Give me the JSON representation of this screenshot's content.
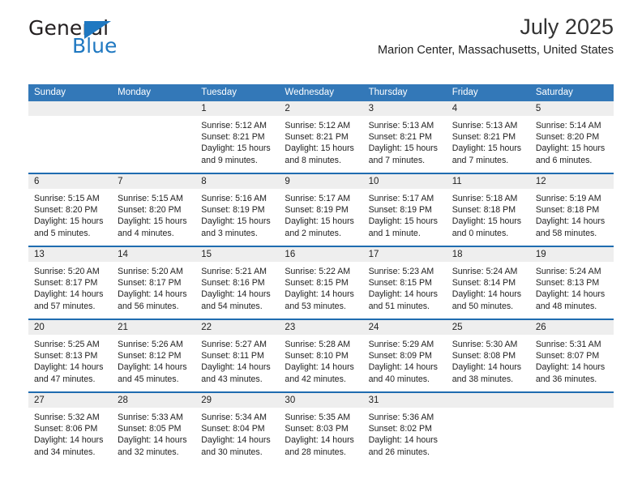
{
  "brand": {
    "name_part1": "General",
    "name_part2": "Blue",
    "triangle_color": "#1f78c1"
  },
  "header": {
    "title": "July 2025",
    "subtitle": "Marion Center, Massachusetts, United States"
  },
  "theme": {
    "header_bg": "#3378b8",
    "row_divider": "#1f6cb0",
    "day_number_bg": "#eeeeee",
    "text": "#222222"
  },
  "calendar": {
    "weekday_headers": [
      "Sunday",
      "Monday",
      "Tuesday",
      "Wednesday",
      "Thursday",
      "Friday",
      "Saturday"
    ],
    "weeks": [
      [
        {
          "day": "",
          "sunrise": "",
          "sunset": "",
          "daylight_line1": "",
          "daylight_line2": ""
        },
        {
          "day": "",
          "sunrise": "",
          "sunset": "",
          "daylight_line1": "",
          "daylight_line2": ""
        },
        {
          "day": "1",
          "sunrise": "Sunrise: 5:12 AM",
          "sunset": "Sunset: 8:21 PM",
          "daylight_line1": "Daylight: 15 hours",
          "daylight_line2": "and 9 minutes."
        },
        {
          "day": "2",
          "sunrise": "Sunrise: 5:12 AM",
          "sunset": "Sunset: 8:21 PM",
          "daylight_line1": "Daylight: 15 hours",
          "daylight_line2": "and 8 minutes."
        },
        {
          "day": "3",
          "sunrise": "Sunrise: 5:13 AM",
          "sunset": "Sunset: 8:21 PM",
          "daylight_line1": "Daylight: 15 hours",
          "daylight_line2": "and 7 minutes."
        },
        {
          "day": "4",
          "sunrise": "Sunrise: 5:13 AM",
          "sunset": "Sunset: 8:21 PM",
          "daylight_line1": "Daylight: 15 hours",
          "daylight_line2": "and 7 minutes."
        },
        {
          "day": "5",
          "sunrise": "Sunrise: 5:14 AM",
          "sunset": "Sunset: 8:20 PM",
          "daylight_line1": "Daylight: 15 hours",
          "daylight_line2": "and 6 minutes."
        }
      ],
      [
        {
          "day": "6",
          "sunrise": "Sunrise: 5:15 AM",
          "sunset": "Sunset: 8:20 PM",
          "daylight_line1": "Daylight: 15 hours",
          "daylight_line2": "and 5 minutes."
        },
        {
          "day": "7",
          "sunrise": "Sunrise: 5:15 AM",
          "sunset": "Sunset: 8:20 PM",
          "daylight_line1": "Daylight: 15 hours",
          "daylight_line2": "and 4 minutes."
        },
        {
          "day": "8",
          "sunrise": "Sunrise: 5:16 AM",
          "sunset": "Sunset: 8:19 PM",
          "daylight_line1": "Daylight: 15 hours",
          "daylight_line2": "and 3 minutes."
        },
        {
          "day": "9",
          "sunrise": "Sunrise: 5:17 AM",
          "sunset": "Sunset: 8:19 PM",
          "daylight_line1": "Daylight: 15 hours",
          "daylight_line2": "and 2 minutes."
        },
        {
          "day": "10",
          "sunrise": "Sunrise: 5:17 AM",
          "sunset": "Sunset: 8:19 PM",
          "daylight_line1": "Daylight: 15 hours",
          "daylight_line2": "and 1 minute."
        },
        {
          "day": "11",
          "sunrise": "Sunrise: 5:18 AM",
          "sunset": "Sunset: 8:18 PM",
          "daylight_line1": "Daylight: 15 hours",
          "daylight_line2": "and 0 minutes."
        },
        {
          "day": "12",
          "sunrise": "Sunrise: 5:19 AM",
          "sunset": "Sunset: 8:18 PM",
          "daylight_line1": "Daylight: 14 hours",
          "daylight_line2": "and 58 minutes."
        }
      ],
      [
        {
          "day": "13",
          "sunrise": "Sunrise: 5:20 AM",
          "sunset": "Sunset: 8:17 PM",
          "daylight_line1": "Daylight: 14 hours",
          "daylight_line2": "and 57 minutes."
        },
        {
          "day": "14",
          "sunrise": "Sunrise: 5:20 AM",
          "sunset": "Sunset: 8:17 PM",
          "daylight_line1": "Daylight: 14 hours",
          "daylight_line2": "and 56 minutes."
        },
        {
          "day": "15",
          "sunrise": "Sunrise: 5:21 AM",
          "sunset": "Sunset: 8:16 PM",
          "daylight_line1": "Daylight: 14 hours",
          "daylight_line2": "and 54 minutes."
        },
        {
          "day": "16",
          "sunrise": "Sunrise: 5:22 AM",
          "sunset": "Sunset: 8:15 PM",
          "daylight_line1": "Daylight: 14 hours",
          "daylight_line2": "and 53 minutes."
        },
        {
          "day": "17",
          "sunrise": "Sunrise: 5:23 AM",
          "sunset": "Sunset: 8:15 PM",
          "daylight_line1": "Daylight: 14 hours",
          "daylight_line2": "and 51 minutes."
        },
        {
          "day": "18",
          "sunrise": "Sunrise: 5:24 AM",
          "sunset": "Sunset: 8:14 PM",
          "daylight_line1": "Daylight: 14 hours",
          "daylight_line2": "and 50 minutes."
        },
        {
          "day": "19",
          "sunrise": "Sunrise: 5:24 AM",
          "sunset": "Sunset: 8:13 PM",
          "daylight_line1": "Daylight: 14 hours",
          "daylight_line2": "and 48 minutes."
        }
      ],
      [
        {
          "day": "20",
          "sunrise": "Sunrise: 5:25 AM",
          "sunset": "Sunset: 8:13 PM",
          "daylight_line1": "Daylight: 14 hours",
          "daylight_line2": "and 47 minutes."
        },
        {
          "day": "21",
          "sunrise": "Sunrise: 5:26 AM",
          "sunset": "Sunset: 8:12 PM",
          "daylight_line1": "Daylight: 14 hours",
          "daylight_line2": "and 45 minutes."
        },
        {
          "day": "22",
          "sunrise": "Sunrise: 5:27 AM",
          "sunset": "Sunset: 8:11 PM",
          "daylight_line1": "Daylight: 14 hours",
          "daylight_line2": "and 43 minutes."
        },
        {
          "day": "23",
          "sunrise": "Sunrise: 5:28 AM",
          "sunset": "Sunset: 8:10 PM",
          "daylight_line1": "Daylight: 14 hours",
          "daylight_line2": "and 42 minutes."
        },
        {
          "day": "24",
          "sunrise": "Sunrise: 5:29 AM",
          "sunset": "Sunset: 8:09 PM",
          "daylight_line1": "Daylight: 14 hours",
          "daylight_line2": "and 40 minutes."
        },
        {
          "day": "25",
          "sunrise": "Sunrise: 5:30 AM",
          "sunset": "Sunset: 8:08 PM",
          "daylight_line1": "Daylight: 14 hours",
          "daylight_line2": "and 38 minutes."
        },
        {
          "day": "26",
          "sunrise": "Sunrise: 5:31 AM",
          "sunset": "Sunset: 8:07 PM",
          "daylight_line1": "Daylight: 14 hours",
          "daylight_line2": "and 36 minutes."
        }
      ],
      [
        {
          "day": "27",
          "sunrise": "Sunrise: 5:32 AM",
          "sunset": "Sunset: 8:06 PM",
          "daylight_line1": "Daylight: 14 hours",
          "daylight_line2": "and 34 minutes."
        },
        {
          "day": "28",
          "sunrise": "Sunrise: 5:33 AM",
          "sunset": "Sunset: 8:05 PM",
          "daylight_line1": "Daylight: 14 hours",
          "daylight_line2": "and 32 minutes."
        },
        {
          "day": "29",
          "sunrise": "Sunrise: 5:34 AM",
          "sunset": "Sunset: 8:04 PM",
          "daylight_line1": "Daylight: 14 hours",
          "daylight_line2": "and 30 minutes."
        },
        {
          "day": "30",
          "sunrise": "Sunrise: 5:35 AM",
          "sunset": "Sunset: 8:03 PM",
          "daylight_line1": "Daylight: 14 hours",
          "daylight_line2": "and 28 minutes."
        },
        {
          "day": "31",
          "sunrise": "Sunrise: 5:36 AM",
          "sunset": "Sunset: 8:02 PM",
          "daylight_line1": "Daylight: 14 hours",
          "daylight_line2": "and 26 minutes."
        },
        {
          "day": "",
          "sunrise": "",
          "sunset": "",
          "daylight_line1": "",
          "daylight_line2": ""
        },
        {
          "day": "",
          "sunrise": "",
          "sunset": "",
          "daylight_line1": "",
          "daylight_line2": ""
        }
      ]
    ]
  }
}
